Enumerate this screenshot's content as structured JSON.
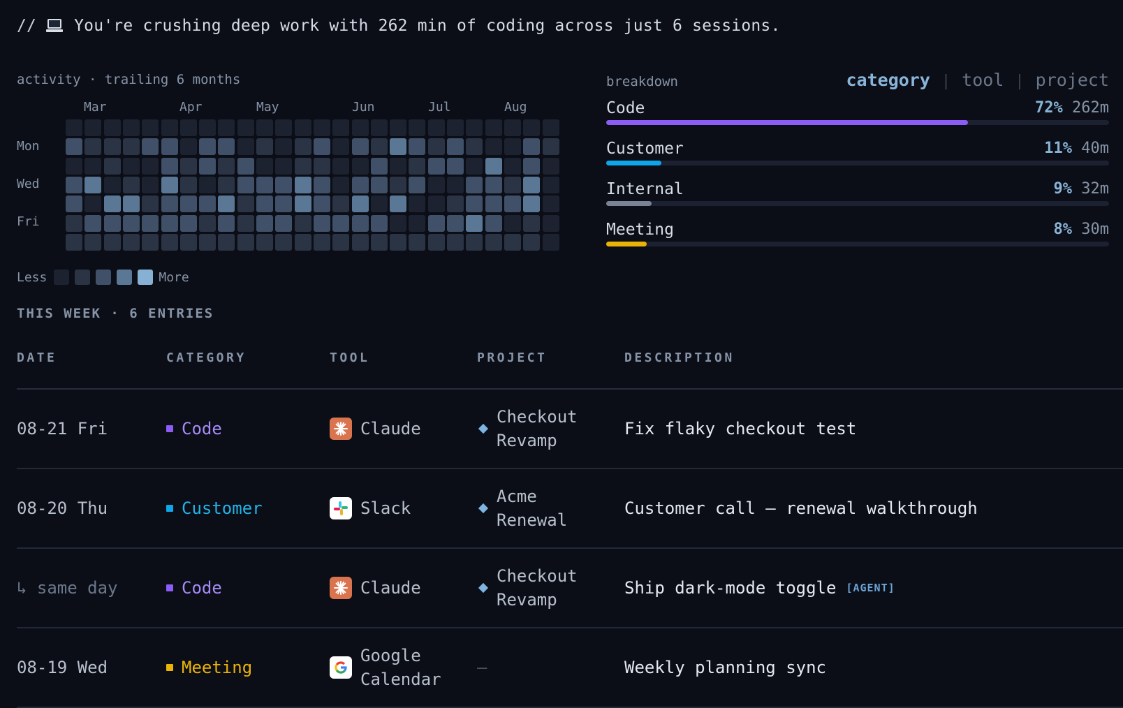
{
  "insight": {
    "prefix": "//",
    "icon": "laptop-icon",
    "text": "You're crushing deep work with 262 min of coding across just 6 sessions."
  },
  "activity": {
    "title": "activity · trailing 6 months",
    "months": [
      "Mar",
      "Apr",
      "May",
      "Jun",
      "Jul",
      "Aug"
    ],
    "day_labels": [
      "Mon",
      "Wed",
      "Fri"
    ],
    "legend": {
      "less": "Less",
      "more": "More"
    },
    "palette": [
      "#1c2230",
      "#2b3445",
      "#3f5068",
      "#5a7896",
      "#86b0d4"
    ],
    "grid": [
      [
        0,
        0,
        0,
        0,
        0,
        0,
        0,
        0,
        0,
        0,
        0,
        0,
        0,
        0,
        0,
        0,
        0,
        0,
        0,
        0,
        0,
        0,
        0,
        0,
        0,
        0
      ],
      [
        2,
        1,
        1,
        1,
        2,
        2,
        0,
        2,
        2,
        0,
        1,
        0,
        1,
        2,
        0,
        2,
        1,
        3,
        2,
        1,
        2,
        1,
        0,
        0,
        2,
        1
      ],
      [
        0,
        0,
        1,
        0,
        0,
        2,
        1,
        2,
        1,
        2,
        0,
        0,
        1,
        1,
        0,
        0,
        2,
        0,
        1,
        2,
        2,
        0,
        3,
        0,
        2,
        0
      ],
      [
        2,
        3,
        0,
        1,
        0,
        3,
        1,
        0,
        1,
        2,
        2,
        2,
        3,
        2,
        0,
        2,
        2,
        1,
        2,
        0,
        0,
        2,
        2,
        1,
        3,
        0
      ],
      [
        2,
        0,
        3,
        3,
        1,
        2,
        2,
        2,
        3,
        1,
        2,
        2,
        3,
        2,
        1,
        3,
        0,
        3,
        0,
        0,
        1,
        2,
        2,
        2,
        3,
        0
      ],
      [
        1,
        2,
        2,
        2,
        2,
        2,
        2,
        1,
        2,
        1,
        2,
        2,
        1,
        2,
        2,
        2,
        2,
        0,
        0,
        2,
        2,
        3,
        2,
        0,
        1,
        0
      ],
      [
        1,
        1,
        1,
        1,
        1,
        1,
        1,
        1,
        1,
        1,
        1,
        1,
        1,
        1,
        1,
        1,
        1,
        1,
        1,
        1,
        1,
        1,
        1,
        1,
        1,
        0
      ]
    ]
  },
  "breakdown": {
    "title": "breakdown",
    "tabs": [
      {
        "label": "category",
        "active": true
      },
      {
        "label": "tool",
        "active": false
      },
      {
        "label": "project",
        "active": false
      }
    ],
    "tab_sep": "|",
    "rows": [
      {
        "name": "Code",
        "pct": "72%",
        "mins": "262m",
        "fraction": 0.72,
        "color": "#8b5cf6"
      },
      {
        "name": "Customer",
        "pct": "11%",
        "mins": "40m",
        "fraction": 0.11,
        "color": "#0ea5e9"
      },
      {
        "name": "Internal",
        "pct": "9%",
        "mins": "32m",
        "fraction": 0.09,
        "color": "#7a8296"
      },
      {
        "name": "Meeting",
        "pct": "8%",
        "mins": "30m",
        "fraction": 0.08,
        "color": "#eab308"
      }
    ]
  },
  "week": {
    "title": "THIS WEEK · 6 ENTRIES",
    "columns": [
      "DATE",
      "CATEGORY",
      "TOOL",
      "PROJECT",
      "DESCRIPTION"
    ],
    "rows": [
      {
        "date": "08-21 Fri",
        "date_sub": false,
        "category": "Code",
        "cat_color": "#8b5cf6",
        "cat_text": "#a78bfa",
        "tool": "Claude",
        "tool_icon": "claude-icon",
        "project": "Checkout Revamp",
        "description": "Fix flaky checkout test",
        "badge": ""
      },
      {
        "date": "08-20 Thu",
        "date_sub": false,
        "category": "Customer",
        "cat_color": "#0ea5e9",
        "cat_text": "#22b3ea",
        "tool": "Slack",
        "tool_icon": "slack-icon",
        "project": "Acme Renewal",
        "description": "Customer call — renewal walkthrough",
        "badge": ""
      },
      {
        "date": "↳ same day",
        "date_sub": true,
        "category": "Code",
        "cat_color": "#8b5cf6",
        "cat_text": "#a78bfa",
        "tool": "Claude",
        "tool_icon": "claude-icon",
        "project": "Checkout Revamp",
        "description": "Ship dark-mode toggle",
        "badge": "[AGENT]"
      },
      {
        "date": "08-19 Wed",
        "date_sub": false,
        "category": "Meeting",
        "cat_color": "#eab308",
        "cat_text": "#eab308",
        "tool": "Google Calendar",
        "tool_icon": "google-calendar-icon",
        "project": "—",
        "description": "Weekly planning sync",
        "badge": ""
      }
    ]
  }
}
